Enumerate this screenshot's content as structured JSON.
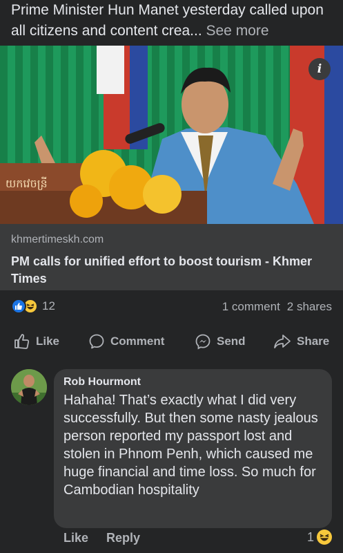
{
  "post": {
    "text": "Prime Minister Hun Manet yesterday called upon all citizens and content crea...",
    "see_more": " See more"
  },
  "link": {
    "domain": "khmertimeskh.com",
    "title": "PM calls for unified effort to boost tourism - Khmer Times",
    "info_glyph": "i",
    "podium_text": "យកវេចន្រី"
  },
  "stats": {
    "reaction_count": "12",
    "comments": "1 comment",
    "shares": "2 shares"
  },
  "actions": {
    "like": "Like",
    "comment": "Comment",
    "send": "Send",
    "share": "Share"
  },
  "comment": {
    "author": "Rob Hourmont",
    "text": "Hahaha! That’s exactly what I did very successfully. But then some nasty jealous person reported my passport lost and stolen in Phnom Penh, which caused me huge financial and time loss. So much for Cambodian hospitality",
    "like": "Like",
    "reply": "Reply",
    "reaction_count": "1"
  },
  "colors": {
    "background": "#242526",
    "card": "#3a3b3c",
    "like_blue": "#1b74e4",
    "haha_yellow": "#f7c83c"
  }
}
